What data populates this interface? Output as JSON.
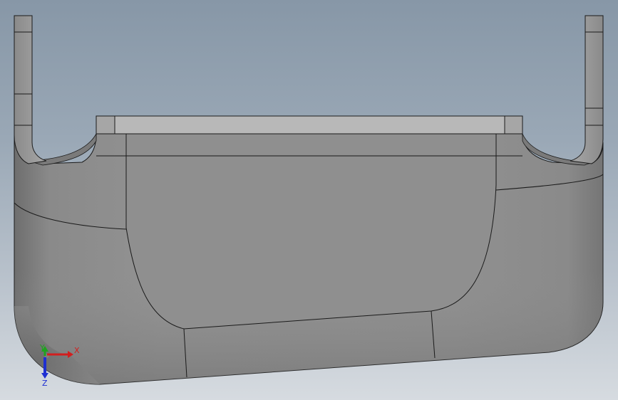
{
  "viewport": {
    "background_top": "#8797a7",
    "background_bottom": "#d6dbe0"
  },
  "model": {
    "body_color": "#8f8f8f",
    "edge_color": "#1a1a1a"
  },
  "triad": {
    "x_label": "X",
    "y_label": "Y",
    "z_label": "Z",
    "x_color": "#d21e1e",
    "y_color": "#1fa31f",
    "z_color": "#1e2fd2"
  }
}
